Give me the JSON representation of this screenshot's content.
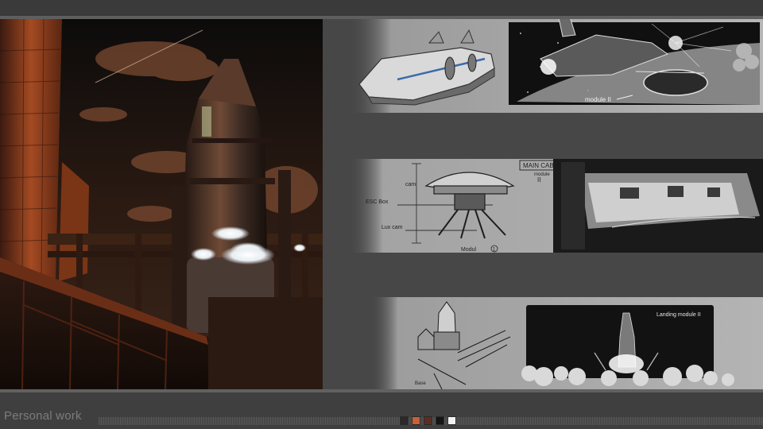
{
  "footer": {
    "label": "Personal work"
  },
  "palette": [
    "#2a2a2a",
    "#c8603a",
    "#5a2f22",
    "#151515",
    "#f2f2f2"
  ],
  "sketches": {
    "panel_1_note": "module II",
    "panel_2_title": "MAIN CAB",
    "panel_2_module_label": "module",
    "panel_2_roman": "II",
    "panel_2_label_top": "cam",
    "panel_2_label_mid": "ESC Box",
    "panel_2_label_low": "Lux cam",
    "panel_2_caption": "Modul",
    "panel_2_caption_num": "1",
    "panel_3_note": "Landing module II",
    "panel_3_tag": "Base"
  }
}
